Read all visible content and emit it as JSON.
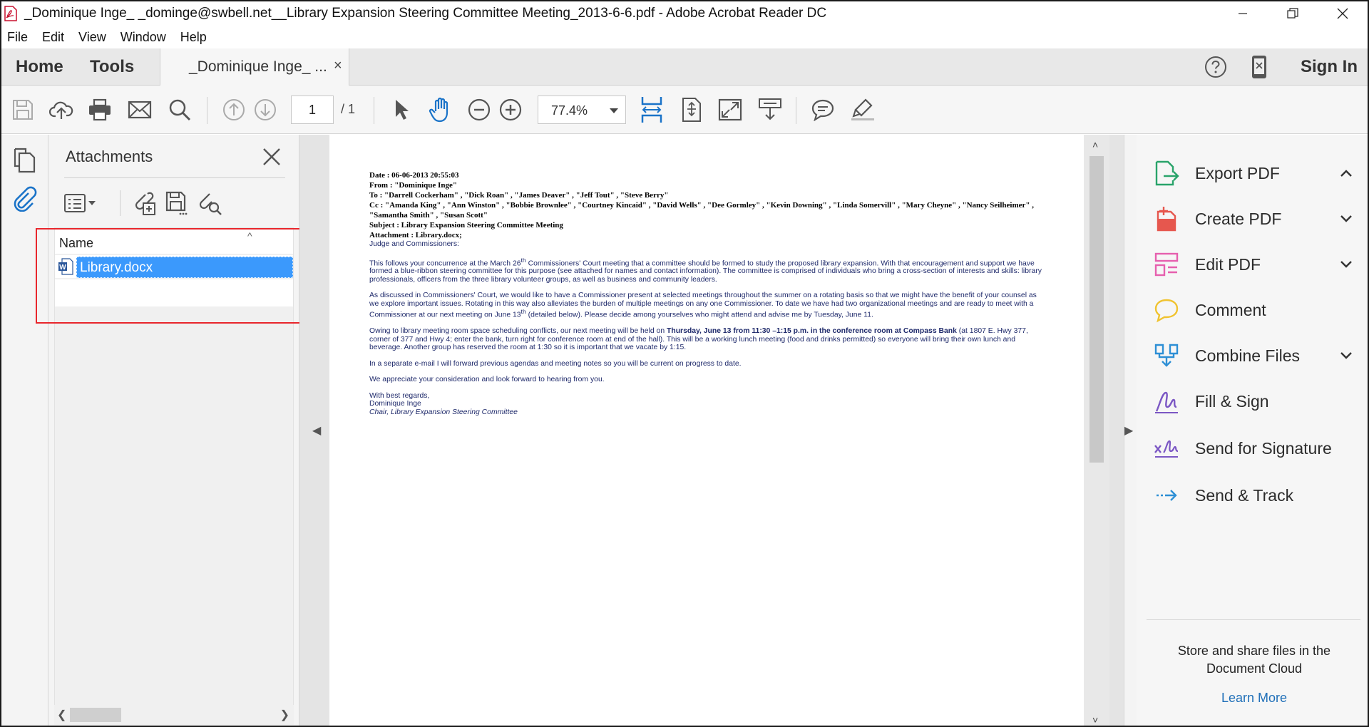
{
  "window": {
    "title": "_Dominique Inge_ _dominge@swbell.net__Library Expansion Steering Committee Meeting_2013-6-6.pdf - Adobe Acrobat Reader DC"
  },
  "menu": [
    "File",
    "Edit",
    "View",
    "Window",
    "Help"
  ],
  "tabs": {
    "home": "Home",
    "tools": "Tools",
    "document": "_Dominique Inge_ ...",
    "close": "×",
    "sign_in": "Sign In"
  },
  "toolbar": {
    "page_current": "1",
    "page_total": "/ 1",
    "zoom": "77.4%"
  },
  "attachments": {
    "title": "Attachments",
    "column_name": "Name",
    "sort_indicator": "^",
    "files": [
      {
        "name": "Library.docx",
        "icon": "word-doc-icon"
      }
    ]
  },
  "document": {
    "date": "Date : 06-06-2013 20:55:03",
    "from": "From : \"Dominique Inge\"",
    "to": "To : \"Darrell Cockerham\" , \"Dick Roan\" , \"James Deaver\" , \"Jeff Tout\" , \"Steve Berry\"",
    "cc": "Cc : \"Amanda King\" , \"Ann Winston\" , \"Bobbie Brownlee\" , \"Courtney Kincaid\" , \"David Wells\" , \"Dee Gormley\" , \"Kevin Downing\" , \"Linda Somervill\" , \"Mary Cheyne\" , \"Nancy Seilheimer\" , \"Samantha Smith\" , \"Susan Scott\"",
    "subject": "Subject : Library Expansion Steering Committee Meeting",
    "attachment": "Attachment : Library.docx;",
    "greeting": "Judge and Commissioners:",
    "p1a": "This follows your concurrence at the March 26",
    "p1_sup": "th",
    "p1b": " Commissioners' Court meeting that a committee should be formed to study the proposed library expansion.  With that encouragement and support we have formed a blue-ribbon steering committee for this purpose (see attached for names and contact information).  The committee is comprised of individuals who bring a cross-section of interests and skills: library professionals, officers from the three library volunteer groups, as well as business and community leaders.",
    "p2a": "As discussed in Commissioners' Court, we would like to have a Commissioner present at selected meetings throughout the summer on a rotating basis so that we might have the benefit of your counsel as we explore important issues.  Rotating in this way also alleviates the burden of multiple meetings on any one Commissioner.  To date we have had two organizational meetings and are ready to meet with a Commissioner at our next meeting on June 13",
    "p2_sup": "th",
    "p2b": " (detailed below).  Please decide among yourselves who might attend and advise me by Tuesday, June 11.",
    "p3a": "Owing to library meeting room space scheduling conflicts, our next meeting will be held on ",
    "p3_bold": "Thursday, June 13 from 11:30 –1:15 p.m. in the conference room at Compass Bank",
    "p3b": " (at 1807 E. Hwy 377, corner of 377 and Hwy 4; enter the bank, turn right for conference room at end of the hall).  This will be a working lunch meeting (food and drinks permitted) so everyone will bring their own lunch and beverage.  Another group has reserved the room at 1:30 so it is important that we vacate by 1:15.",
    "p4": "In a separate e-mail I will forward previous agendas and meeting notes so you will be current on progress to date.",
    "p5": "We appreciate your consideration and look forward to hearing from you.",
    "closing": "With best regards,",
    "signer": "Dominique Inge",
    "signer_title": "Chair, Library Expansion Steering Committee"
  },
  "right_panel": {
    "tools": [
      {
        "label": "Export PDF",
        "icon": "export-pdf-icon",
        "chevron": "up"
      },
      {
        "label": "Create PDF",
        "icon": "create-pdf-icon",
        "chevron": "down"
      },
      {
        "label": "Edit PDF",
        "icon": "edit-pdf-icon",
        "chevron": "down"
      },
      {
        "label": "Comment",
        "icon": "comment-icon",
        "chevron": ""
      },
      {
        "label": "Combine Files",
        "icon": "combine-files-icon",
        "chevron": "down"
      },
      {
        "label": "Fill & Sign",
        "icon": "fill-sign-icon",
        "chevron": ""
      },
      {
        "label": "Send for Signature",
        "icon": "send-signature-icon",
        "chevron": ""
      },
      {
        "label": "Send & Track",
        "icon": "send-track-icon",
        "chevron": ""
      }
    ],
    "cloud_text": "Store and share files in the Document Cloud",
    "learn_more": "Learn More"
  },
  "colors": {
    "accent_blue": "#1a73c8",
    "selection": "#3b99fc",
    "highlight_box": "#e8262c",
    "export_green": "#29a36a",
    "create_red": "#e6574e",
    "edit_pink": "#e65fae",
    "comment_yellow": "#f0c330",
    "combine_blue": "#2d8fd5",
    "sign_purple": "#7b57c4"
  }
}
